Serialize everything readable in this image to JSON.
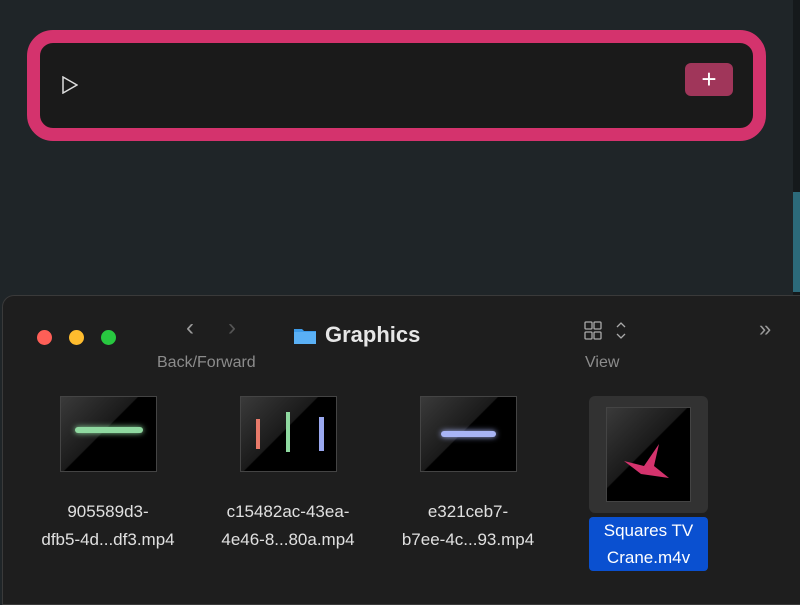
{
  "card": {
    "play_icon": "play-icon",
    "add_label": "+"
  },
  "finder": {
    "title": "Graphics",
    "back_forward_label": "Back/Forward",
    "view_label": "View",
    "files": [
      {
        "line1": "905589d3-",
        "line2": "dfb5-4d...df3.mp4",
        "selected": false
      },
      {
        "line1": "c15482ac-43ea-",
        "line2": "4e46-8...80a.mp4",
        "selected": false
      },
      {
        "line1": "e321ceb7-",
        "line2": "b7ee-4c...93.mp4",
        "selected": false
      },
      {
        "line1": "Squares TV",
        "line2": "Crane.m4v",
        "selected": true
      }
    ]
  },
  "colors": {
    "accent": "#d4336d",
    "selection": "#0a50d0"
  }
}
